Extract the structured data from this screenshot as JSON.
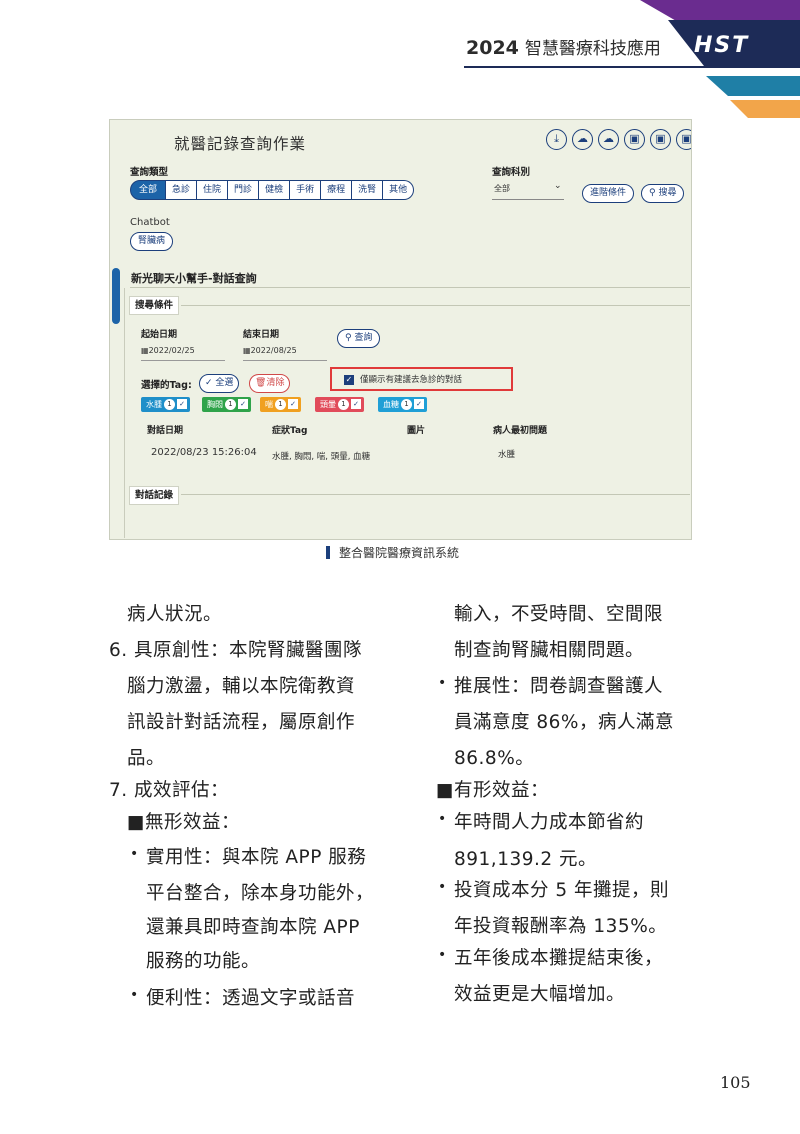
{
  "header": {
    "year": "2024",
    "title": "智慧醫療科技應用",
    "logo": "HST",
    "colors": {
      "navy": "#1d2b57",
      "purple": "#6a2c8f",
      "teal": "#1f7fa6",
      "orange": "#f2a54a"
    }
  },
  "screenshot": {
    "app_title": "就醫記錄查詢作業",
    "toolbar_icons": [
      "download-icon",
      "cloud-upload-icon",
      "cloud-icon",
      "image-icon",
      "image-icon",
      "image-icon"
    ],
    "query_type_label": "查詢類型",
    "query_types": [
      "全部",
      "急診",
      "住院",
      "門診",
      "健檢",
      "手術",
      "療程",
      "洗腎",
      "其他"
    ],
    "dept_label": "查詢科別",
    "dept_value": "全部",
    "advanced_btn": "進階條件",
    "search_btn": "搜尋",
    "chatbot_label": "Chatbot",
    "chatbot_tag": "腎臟病",
    "section_title": "新光聊天小幫手-對話查詢",
    "search_box_title": "搜尋條件",
    "start_date_label": "起始日期",
    "start_date_value": "2022/02/25",
    "end_date_label": "結束日期",
    "end_date_value": "2022/08/25",
    "query_btn": "查詢",
    "tag_select_label": "選擇的Tag:",
    "select_all_btn": "全選",
    "clear_btn": "清除",
    "only_urgent_label": "僅顯示有建議去急診的對話",
    "tags": [
      {
        "name": "水腫",
        "count": "1",
        "color": "#1f8fc9"
      },
      {
        "name": "胸悶",
        "count": "1",
        "color": "#2fa34a"
      },
      {
        "name": "喘",
        "count": "1",
        "color": "#f0a020"
      },
      {
        "name": "頭暈",
        "count": "1",
        "color": "#e14b5a"
      },
      {
        "name": "血糖",
        "count": "1",
        "color": "#1f9fd6"
      }
    ],
    "table_headers": [
      "對話日期",
      "症狀Tag",
      "圖片",
      "病人最初問題"
    ],
    "table_row": [
      "2022/08/23 15:26:04",
      "水腫, 胸悶, 喘, 頭暈, 血糖",
      "",
      "水腫"
    ],
    "records_box_title": "對話記錄"
  },
  "caption": "整合醫院醫療資訊系統",
  "left_column": [
    "病人狀況。",
    "6. 具原創性：本院腎臟醫團隊",
    "腦力激盪，輔以本院衛教資",
    "訊設計對話流程，屬原創作",
    "品。",
    "7. 成效評估：",
    "■無形效益：",
    "實用性：與本院 APP 服務",
    "平台整合，除本身功能外，",
    "還兼具即時查詢本院 APP",
    "服務的功能。",
    "便利性：透過文字或話音"
  ],
  "right_column": [
    "輸入，不受時間、空間限",
    "制查詢腎臟相關問題。",
    "推展性：問卷調查醫護人",
    "員滿意度 86%，病人滿意",
    "86.8%。",
    "■有形效益：",
    "年時間人力成本節省約",
    "891,139.2 元。",
    "投資成本分 5 年攤提，則",
    "年投資報酬率為 135%。",
    "五年後成本攤提結束後，",
    "效益更是大幅增加。"
  ],
  "bullet_symbol": "•",
  "page_number": "105"
}
